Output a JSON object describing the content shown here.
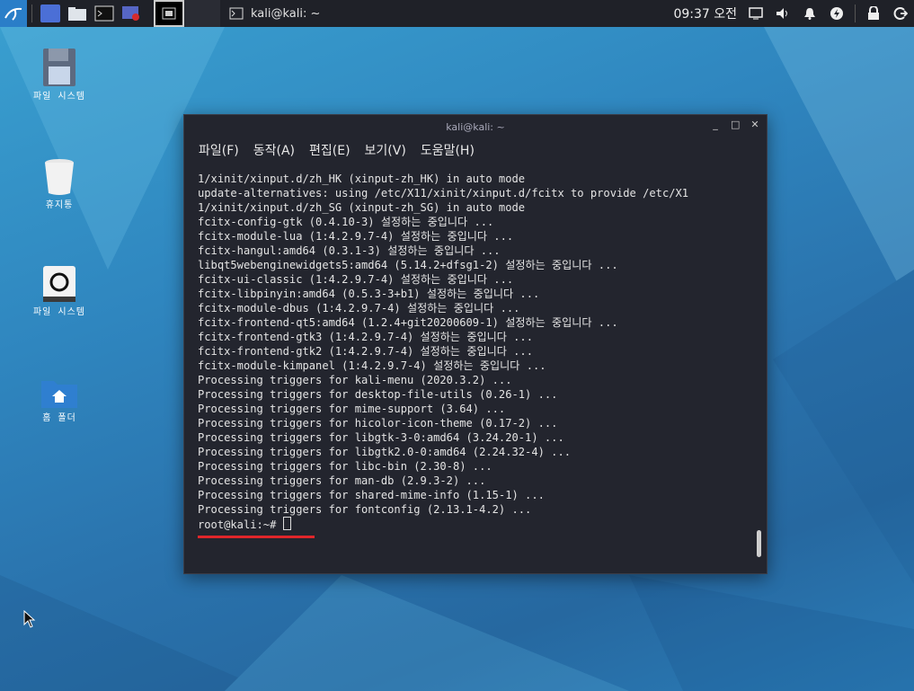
{
  "panel": {
    "clock": "09:37 오전",
    "task_window_title": "kali@kali: ~"
  },
  "desktop": {
    "icons": [
      {
        "name": "save-icon",
        "label_line1": "파일 시스템",
        "label_line2": ""
      },
      {
        "name": "trash-icon",
        "label_line1": "휴지통",
        "label_line2": ""
      },
      {
        "name": "disk-icon",
        "label_line1": "파일 시스템",
        "label_line2": ""
      },
      {
        "name": "home-folder-icon",
        "label_line1": "홈 폴더",
        "label_line2": ""
      }
    ]
  },
  "terminal": {
    "title": "kali@kali: ~",
    "menu": [
      "파일(F)",
      "동작(A)",
      "편집(E)",
      "보기(V)",
      "도움말(H)"
    ],
    "lines": [
      "1/xinit/xinput.d/zh_HK (xinput-zh_HK) in auto mode",
      "update-alternatives: using /etc/X11/xinit/xinput.d/fcitx to provide /etc/X1",
      "1/xinit/xinput.d/zh_SG (xinput-zh_SG) in auto mode",
      "fcitx-config-gtk (0.4.10-3) 설정하는 중입니다 ...",
      "fcitx-module-lua (1:4.2.9.7-4) 설정하는 중입니다 ...",
      "fcitx-hangul:amd64 (0.3.1-3) 설정하는 중입니다 ...",
      "libqt5webenginewidgets5:amd64 (5.14.2+dfsg1-2) 설정하는 중입니다 ...",
      "fcitx-ui-classic (1:4.2.9.7-4) 설정하는 중입니다 ...",
      "fcitx-libpinyin:amd64 (0.5.3-3+b1) 설정하는 중입니다 ...",
      "fcitx-module-dbus (1:4.2.9.7-4) 설정하는 중입니다 ...",
      "fcitx-frontend-qt5:amd64 (1.2.4+git20200609-1) 설정하는 중입니다 ...",
      "fcitx-frontend-gtk3 (1:4.2.9.7-4) 설정하는 중입니다 ...",
      "fcitx-frontend-gtk2 (1:4.2.9.7-4) 설정하는 중입니다 ...",
      "fcitx-module-kimpanel (1:4.2.9.7-4) 설정하는 중입니다 ...",
      "Processing triggers for kali-menu (2020.3.2) ...",
      "Processing triggers for desktop-file-utils (0.26-1) ...",
      "Processing triggers for mime-support (3.64) ...",
      "Processing triggers for hicolor-icon-theme (0.17-2) ...",
      "Processing triggers for libgtk-3-0:amd64 (3.24.20-1) ...",
      "Processing triggers for libgtk2.0-0:amd64 (2.24.32-4) ...",
      "Processing triggers for libc-bin (2.30-8) ...",
      "Processing triggers for man-db (2.9.3-2) ...",
      "Processing triggers for shared-mime-info (1.15-1) ...",
      "Processing triggers for fontconfig (2.13.1-4.2) ..."
    ],
    "prompt": "root@kali:~# "
  },
  "colors": {
    "panel_bg": "#1f2128",
    "terminal_bg": "#23252e",
    "underline_red": "#e0262a",
    "desktop_blue": "#2f86bf"
  }
}
